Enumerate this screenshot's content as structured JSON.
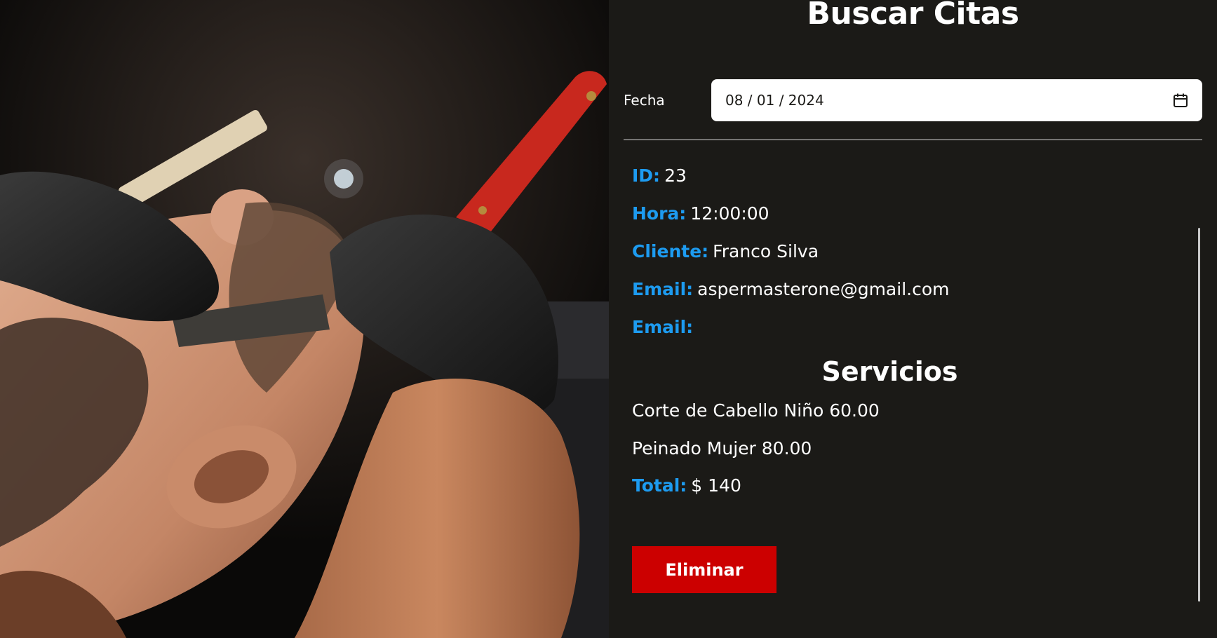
{
  "page": {
    "title": "Buscar Citas"
  },
  "date_filter": {
    "label": "Fecha",
    "value": "08 / 01 / 2024"
  },
  "appointment": {
    "id_label": "ID:",
    "id_value": "23",
    "time_label": "Hora:",
    "time_value": "12:00:00",
    "client_label": "Cliente:",
    "client_value": "Franco Silva",
    "email_label": "Email:",
    "email_value": "aspermasterone@gmail.com",
    "email2_label": "Email:",
    "email2_value": ""
  },
  "services": {
    "title": "Servicios",
    "items": [
      "Corte de Cabello Niño 60.00",
      "Peinado Mujer 80.00"
    ]
  },
  "total": {
    "label": "Total:",
    "value": "$ 140"
  },
  "actions": {
    "delete_label": "Eliminar"
  },
  "colors": {
    "background": "#1b1a17",
    "accent": "#1d9bf0",
    "danger": "#cc0000"
  }
}
